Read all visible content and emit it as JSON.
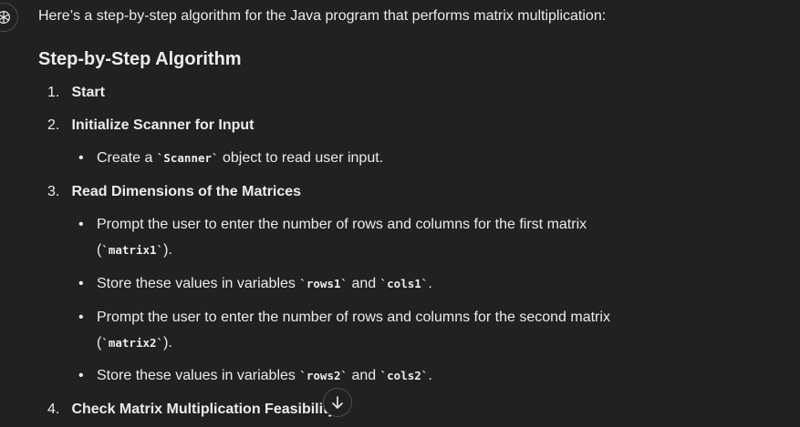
{
  "assistant": {
    "avatar_icon": "openai-logo-icon"
  },
  "message": {
    "intro": "Here’s a step-by-step algorithm for the Java program that performs matrix multiplication:",
    "heading": "Step-by-Step Algorithm",
    "steps": [
      {
        "number": "1.",
        "title": "Start"
      },
      {
        "number": "2.",
        "title": "Initialize Scanner for Input"
      },
      {
        "number": "3.",
        "title": "Read Dimensions of the Matrices"
      },
      {
        "number": "4.",
        "title": "Check Matrix Multiplication Feasibility"
      }
    ],
    "step2_bullet": {
      "before": "Create a ",
      "code": "`Scanner`",
      "after": " object to read user input."
    },
    "step3_bullets": [
      {
        "line1": "Prompt the user to enter the number of rows and columns for the first matrix",
        "open": "(",
        "code": "`matrix1`",
        "close": ")."
      },
      {
        "before": "Store these values in variables ",
        "code1": "`rows1`",
        "middle": " and ",
        "code2": "`cols1`",
        "after": "."
      },
      {
        "line1": "Prompt the user to enter the number of rows and columns for the second matrix",
        "open": "(",
        "code": "`matrix2`",
        "close": ")."
      },
      {
        "before": "Store these values in variables ",
        "code1": "`rows2`",
        "middle": " and ",
        "code2": "`cols2`",
        "after": "."
      }
    ]
  },
  "scroll_button": {
    "icon": "arrow-down-icon"
  }
}
